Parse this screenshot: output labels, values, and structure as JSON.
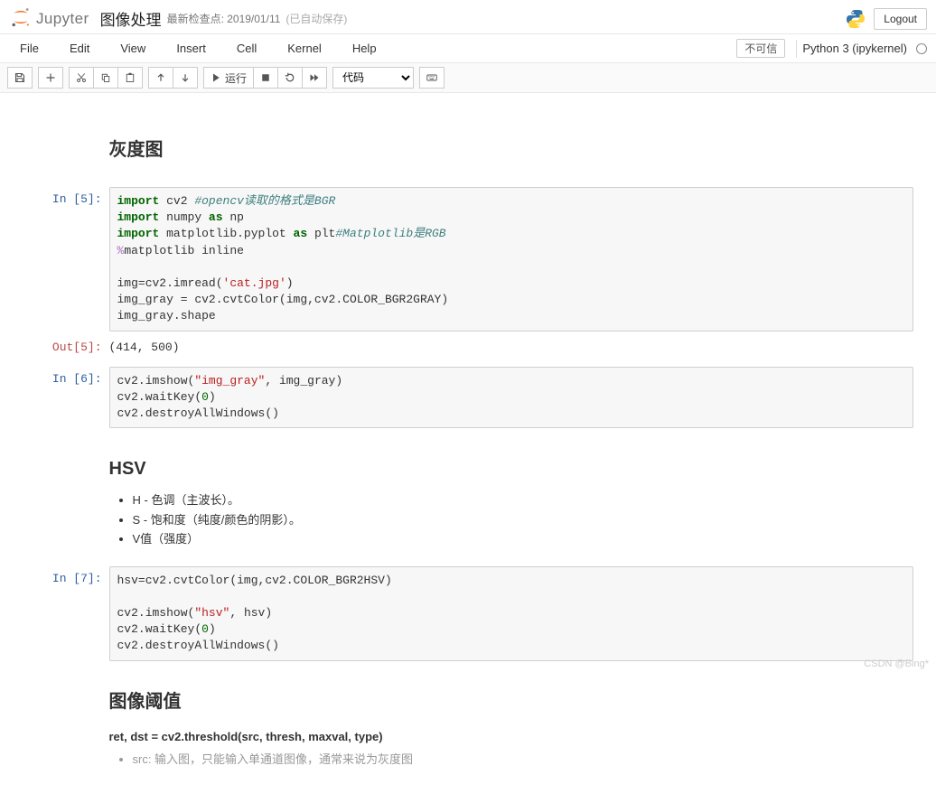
{
  "header": {
    "brand": "Jupyter",
    "notebook_name": "图像处理",
    "checkpoint": "最新检查点: 2019/01/11",
    "autosave": "(已自动保存)",
    "logout": "Logout"
  },
  "menubar": {
    "items": [
      "File",
      "Edit",
      "View",
      "Insert",
      "Cell",
      "Kernel",
      "Help"
    ],
    "trust_badge": "不可信",
    "kernel": "Python 3 (ipykernel)"
  },
  "toolbar": {
    "run_label": "运行",
    "cell_type": "代码"
  },
  "md1": {
    "heading": "灰度图"
  },
  "code1": {
    "prompt": "In  [5]:",
    "l1a": "import",
    "l1b": " cv2 ",
    "l1c": "#opencv读取的格式是BGR",
    "l2a": "import",
    "l2b": " numpy ",
    "l2c": "as",
    "l2d": " np",
    "l3a": "import",
    "l3b": " matplotlib.pyplot ",
    "l3c": "as",
    "l3d": " plt",
    "l3e": "#Matplotlib是RGB",
    "l4a": "%",
    "l4b": "matplotlib inline",
    "l6": "img=cv2.imread(",
    "l6s": "'cat.jpg'",
    "l6b": ")",
    "l7": "img_gray = cv2.cvtColor(img,cv2.COLOR_BGR2GRAY)",
    "l8": "img_gray.shape"
  },
  "out1": {
    "prompt": "Out[5]:",
    "text": "(414, 500)"
  },
  "code2": {
    "prompt": "In  [6]:",
    "l1a": "cv2.imshow(",
    "l1s": "\"img_gray\"",
    "l1b": ", img_gray)",
    "l2a": "cv2.waitKey(",
    "l2n": "0",
    "l2b": ")",
    "l3": "cv2.destroyAllWindows()"
  },
  "md2": {
    "heading": "HSV",
    "li1": "H - 色调（主波长）。",
    "li2": "S - 饱和度（纯度/颜色的阴影）。",
    "li3": "V值（强度）"
  },
  "code3": {
    "prompt": "In  [7]:",
    "l1": "hsv=cv2.cvtColor(img,cv2.COLOR_BGR2HSV)",
    "l3a": "cv2.imshow(",
    "l3s": "\"hsv\"",
    "l3b": ", hsv)",
    "l4a": "cv2.waitKey(",
    "l4n": "0",
    "l4b": ")",
    "l5": "cv2.destroyAllWindows()"
  },
  "md3": {
    "heading": "图像阈值",
    "sig": "ret, dst = cv2.threshold(src, thresh, maxval, type)",
    "li1": "src:    输入图，只能输入单通道图像，通常来说为灰度图"
  },
  "watermark": "CSDN @Bing*"
}
